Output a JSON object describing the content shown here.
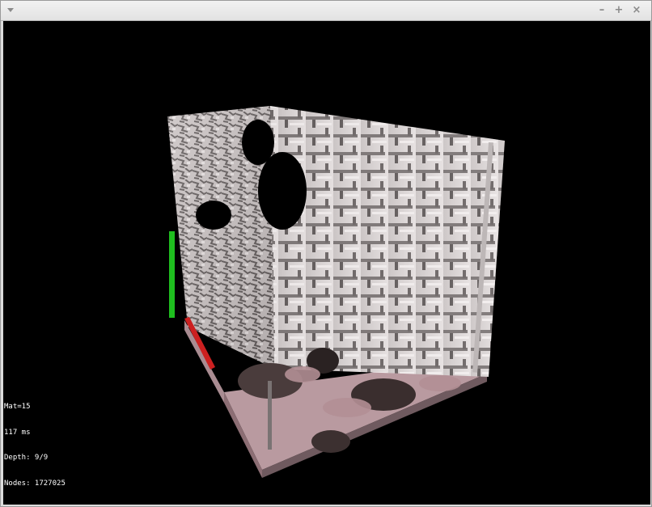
{
  "window": {
    "menu_icon": "menu-arrow-icon",
    "controls": {
      "minimize": "–",
      "maximize": "+",
      "close": "×"
    }
  },
  "scene": {
    "background_color": "#000000",
    "axis_colors": {
      "x": "#cc2020",
      "y": "#1fbf1f"
    },
    "surface_color": "#d8d2d2",
    "floor_color": "#c9a6ab"
  },
  "stats": {
    "mat": "Mat=15",
    "time": "117 ms",
    "depth": "Depth: 9/9",
    "nodes": "Nodes: 1727025"
  }
}
